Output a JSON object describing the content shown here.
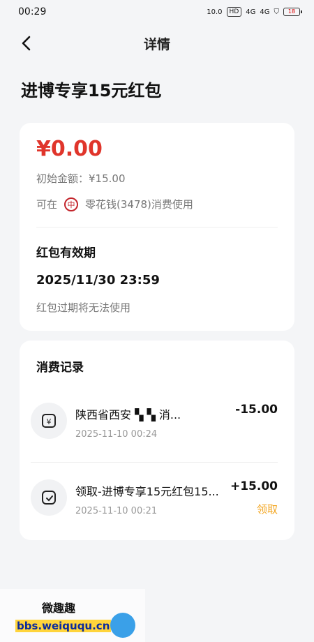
{
  "status_bar": {
    "time": "00:29",
    "net_speed": "10.0",
    "net_unit": "KB/S",
    "hd": "HD",
    "sig1": "4G",
    "sig2": "4G",
    "battery": "18"
  },
  "nav": {
    "title": "详情"
  },
  "page_title": "进博专享15元红包",
  "card": {
    "amount": "¥0.00",
    "initial_label": "初始金额：¥15.00",
    "use_prefix": "可在",
    "use_merchant": "零花钱(3478)消费使用",
    "validity_label": "红包有效期",
    "expiry": "2025/11/30 23:59",
    "expiry_note": "红包过期将无法使用"
  },
  "records": {
    "title": "消费记录",
    "items": [
      {
        "name": "陕西省西安 ▚ ▚ 消...",
        "time": "2025-11-10 00:24",
        "amount": "-15.00",
        "tag": ""
      },
      {
        "name": "领取-进博专享15元红包15...",
        "time": "2025-11-10 00:21",
        "amount": "+15.00",
        "tag": "领取"
      }
    ]
  },
  "watermark": {
    "top": "微趣趣",
    "bottom": "bbs.weiququ.cn"
  },
  "colors": {
    "accent_red": "#e0352b",
    "tag_orange": "#f3a51f",
    "bank_red": "#c3242b"
  }
}
